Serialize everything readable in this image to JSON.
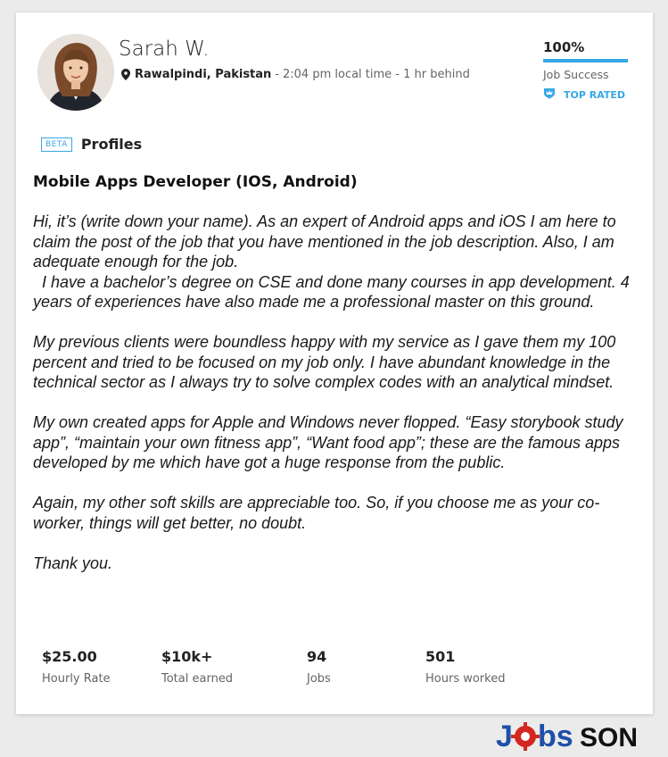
{
  "profile": {
    "name": "Sarah W.",
    "location": "Rawalpindi, Pakistan",
    "separator": "-",
    "local_time": "2:04 pm local time - 1 hr behind",
    "avatar_icon": "avatar-photo"
  },
  "job_success": {
    "value": "100%",
    "fill_fraction": 1.0,
    "label": "Job Success",
    "badge": "TOP RATED",
    "badge_icon": "crown-shield-icon",
    "accent": "#37a7e5"
  },
  "profiles": {
    "beta": "BETA",
    "label": "Profiles"
  },
  "job_title": "Mobile Apps Developer (IOS, Android)",
  "paragraphs": [
    "Hi, it’s (write down your name). As an expert of Android apps and iOS I am here to claim the post of the job that you have mentioned in the job description. Also, I am adequate enough for the job.\n  I have a bachelor’s degree on CSE and done many courses in app development. 4 years of experiences have also made me a professional master on this ground.",
    "My previous clients were boundless happy with my service as I gave them my 100 percent and tried to be focused on my job only. I have abundant knowledge in the technical sector as I always try to solve complex codes with an analytical mindset.",
    "My own created apps for Apple and Windows never flopped. “Easy storybook study app”, “maintain your own fitness app”, “Want food app”; these are the famous apps developed by me which have got a huge response from the public.",
    "Again, my other soft skills are appreciable too. So, if you choose me as your co-worker, things will get better, no doubt.",
    "Thank you."
  ],
  "stats": [
    {
      "value": "$25.00",
      "label": "Hourly Rate"
    },
    {
      "value": "$10k+",
      "label": "Total earned"
    },
    {
      "value": "94",
      "label": "Jobs"
    },
    {
      "value": "501",
      "label": "Hours worked"
    }
  ],
  "watermark": {
    "text_j": "J",
    "text_bs": "bs",
    "text_son": "SON",
    "colors": {
      "blue": "#1f4fa8",
      "red": "#d3271f",
      "dark": "#111111"
    }
  }
}
